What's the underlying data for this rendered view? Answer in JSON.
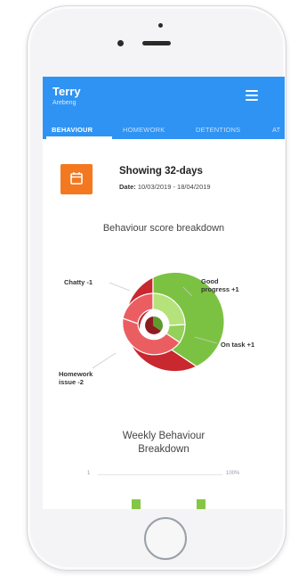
{
  "app": {
    "user_name": "Terry",
    "user_sub": "Arebeng"
  },
  "tabs": [
    {
      "label": "BEHAVIOUR",
      "active": true
    },
    {
      "label": "HOMEWORK",
      "active": false
    },
    {
      "label": "DETENTIONS",
      "active": false
    },
    {
      "label": "AT",
      "active": false
    }
  ],
  "range": {
    "title": "Showing 32-days",
    "date_label": "Date:",
    "date_value": "10/03/2019 - 18/04/2019"
  },
  "behaviour_chart": {
    "title": "Behaviour score breakdown",
    "segments": [
      {
        "label": "Chatty -1",
        "value": -1,
        "color": "#c8282e"
      },
      {
        "label": "Good progress +1",
        "value": 1,
        "color": "#7cc242"
      },
      {
        "label": "On task +1",
        "value": 1,
        "color": "#7cc242"
      },
      {
        "label": "Homework issue -2",
        "value": -2,
        "color": "#c8282e"
      }
    ],
    "colors": {
      "positive": "#7cc242",
      "positive_light": "#b6e27c",
      "negative": "#c8282e",
      "negative_light": "#ea5e62"
    }
  },
  "weekly_chart": {
    "title_line1": "Weekly Behaviour",
    "title_line2": "Breakdown",
    "axis_min": "1",
    "axis_max": "100%"
  }
}
